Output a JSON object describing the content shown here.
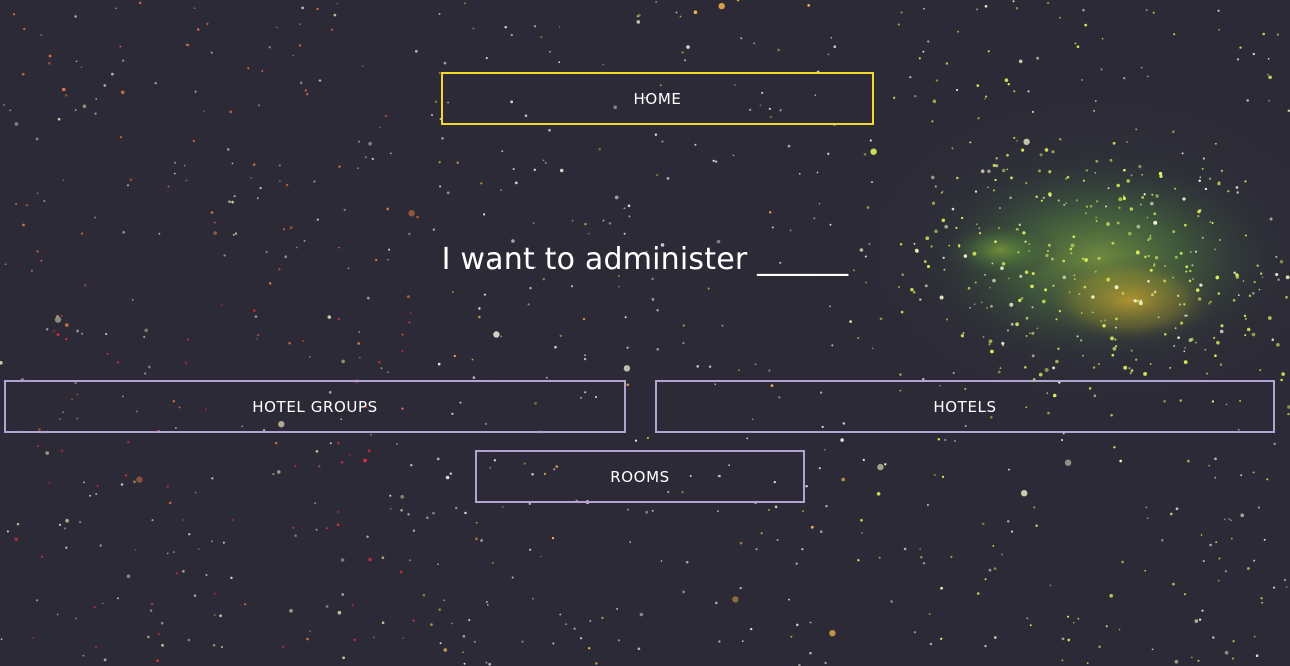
{
  "nav": {
    "home_label": "HOME"
  },
  "main": {
    "headline": "I want to administer ______"
  },
  "options": {
    "hotel_groups_label": "HOTEL GROUPS",
    "hotels_label": "HOTELS",
    "rooms_label": "ROOMS"
  },
  "colors": {
    "background": "#2c2a36",
    "home_border": "#f2d82a",
    "option_border": "#b3a3d2",
    "text": "#ffffff"
  }
}
